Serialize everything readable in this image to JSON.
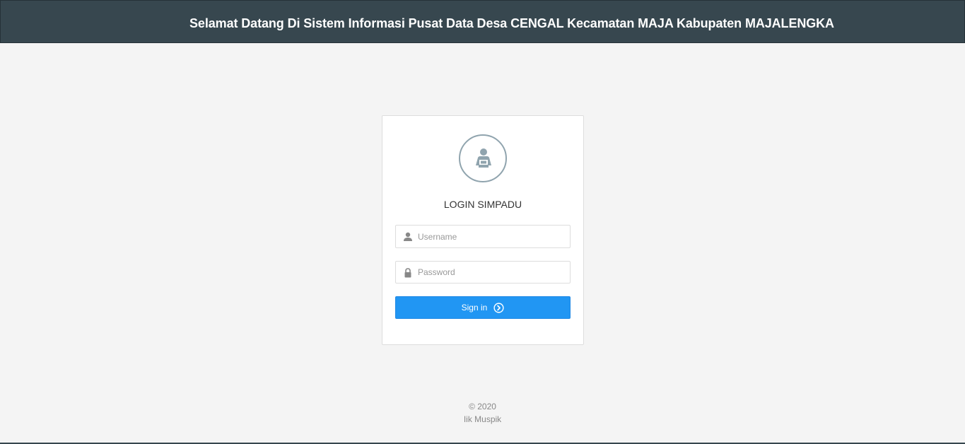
{
  "header": {
    "title": "Selamat Datang Di Sistem Informasi Pusat Data Desa CENGAL Kecamatan MAJA Kabupaten MAJALENGKA"
  },
  "login": {
    "logo_icon": "user-reading-icon",
    "title": "LOGIN SIMPADU",
    "username": {
      "icon": "user-icon",
      "placeholder": "Username",
      "value": ""
    },
    "password": {
      "icon": "lock-icon",
      "placeholder": "Password",
      "value": ""
    },
    "signin": {
      "label": "Sign in",
      "icon": "circle-arrow-right-icon"
    }
  },
  "footer": {
    "copyright": "© 2020",
    "author": "Iik Muspik"
  },
  "colors": {
    "header_bg": "#37474f",
    "page_bg": "#f4f4f4",
    "primary": "#2196f3",
    "logo_gray": "#90a4ae"
  }
}
